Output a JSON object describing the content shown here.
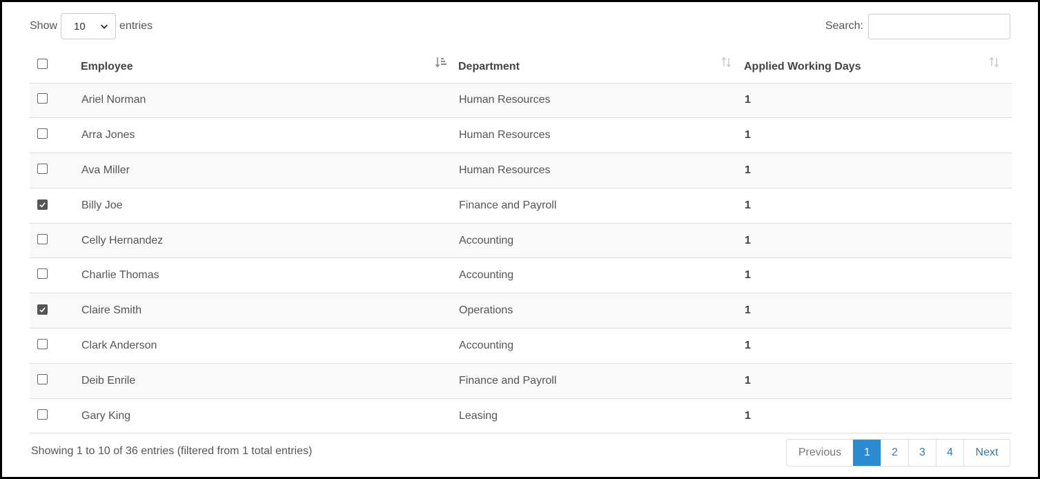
{
  "length_menu": {
    "show_label": "Show",
    "selected": "10",
    "entries_label": "entries"
  },
  "search": {
    "label": "Search:",
    "value": ""
  },
  "columns": [
    {
      "key": "select",
      "label": ""
    },
    {
      "key": "employee",
      "label": "Employee",
      "sort": "ascending"
    },
    {
      "key": "department",
      "label": "Department",
      "sort": "none"
    },
    {
      "key": "applied_working_days",
      "label": "Applied Working Days",
      "sort": "none"
    }
  ],
  "select_all": {
    "checked": false
  },
  "rows": [
    {
      "checked": false,
      "employee": "Ariel Norman",
      "department": "Human Resources",
      "applied_working_days": "1"
    },
    {
      "checked": false,
      "employee": "Arra Jones",
      "department": "Human Resources",
      "applied_working_days": "1"
    },
    {
      "checked": false,
      "employee": "Ava Miller",
      "department": "Human Resources",
      "applied_working_days": "1"
    },
    {
      "checked": true,
      "employee": "Billy Joe",
      "department": "Finance and Payroll",
      "applied_working_days": "1"
    },
    {
      "checked": false,
      "employee": "Celly Hernandez",
      "department": "Accounting",
      "applied_working_days": "1"
    },
    {
      "checked": false,
      "employee": "Charlie Thomas",
      "department": "Accounting",
      "applied_working_days": "1"
    },
    {
      "checked": true,
      "employee": "Claire Smith",
      "department": "Operations",
      "applied_working_days": "1"
    },
    {
      "checked": false,
      "employee": "Clark Anderson",
      "department": "Accounting",
      "applied_working_days": "1"
    },
    {
      "checked": false,
      "employee": "Deib Enrile",
      "department": "Finance and Payroll",
      "applied_working_days": "1"
    },
    {
      "checked": false,
      "employee": "Gary King",
      "department": "Leasing",
      "applied_working_days": "1"
    }
  ],
  "info": "Showing 1 to 10 of 36 entries (filtered from 1 total entries)",
  "pagination": {
    "previous": "Previous",
    "pages": [
      "1",
      "2",
      "3",
      "4"
    ],
    "current": "1",
    "next": "Next"
  },
  "colors": {
    "accent": "#2a8bd0",
    "link": "#2e7bb8",
    "stripe": "#f9f9f9",
    "border": "#dddddd"
  }
}
